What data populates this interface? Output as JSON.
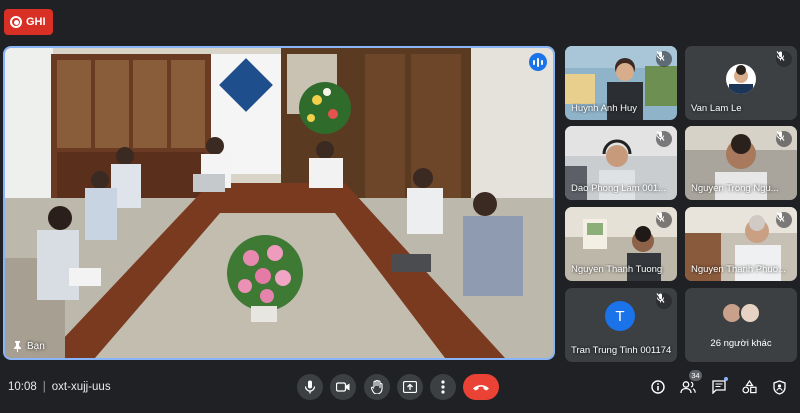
{
  "recording": {
    "label": "GHI"
  },
  "main_tile": {
    "speaker_name": "Bạn"
  },
  "participants": [
    {
      "name": "Huynh Anh Huy",
      "muted": true
    },
    {
      "name": "Van Lam Le",
      "muted": true
    },
    {
      "name": "Dao Phong Lam 001...",
      "muted": true
    },
    {
      "name": "Nguyen Trong Ngu...",
      "muted": true
    },
    {
      "name": "Nguyen Thanh Tuong",
      "muted": true
    },
    {
      "name": "Nguyen Thanh Phuo...",
      "muted": true
    },
    {
      "name": "Tran Trung Tinh 001174",
      "initial": "T",
      "muted": true
    }
  ],
  "others": {
    "label": "26 người khác"
  },
  "meeting": {
    "time": "10:08",
    "separator": "|",
    "code": "oxt-xujj-uus"
  },
  "people_count": "34",
  "controls": [
    "mic-icon",
    "camera-icon",
    "raise-hand-icon",
    "present-icon",
    "more-options-icon",
    "end-call-icon"
  ],
  "right_controls": [
    "info-icon",
    "people-icon",
    "chat-icon",
    "activities-icon",
    "host-controls-icon"
  ],
  "colors": {
    "accent": "#8ab4f8",
    "record": "#d93025",
    "end_call": "#ea4335",
    "avatar_blue": "#1a73e8",
    "background": "#202124",
    "tile": "#3c4043"
  }
}
